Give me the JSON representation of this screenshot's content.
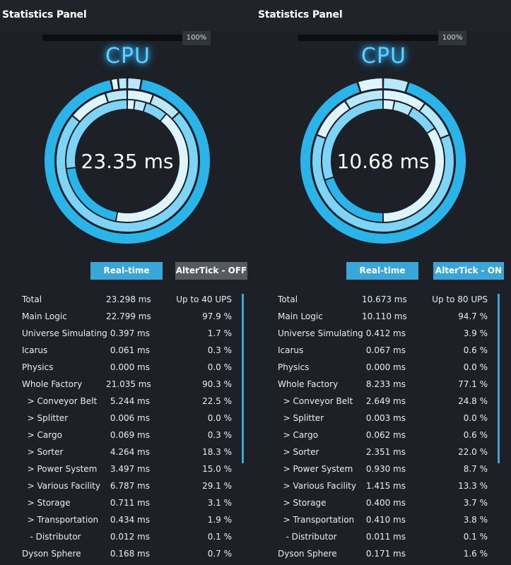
{
  "colors": {
    "accent": "#3aa6d8",
    "ring_dark": "#2bb4ea",
    "ring_mid": "#7dd4f6",
    "ring_light": "#b9e8fb",
    "ring_pale": "#dff5fe",
    "button_off": "#565a61"
  },
  "panels": [
    {
      "title": "Statistics Panel",
      "progress": {
        "label": "100%",
        "value": 100
      },
      "cpu_label": "CPU",
      "ring_value": "23.35 ms",
      "buttons": {
        "realtime": "Real-time",
        "altertick": "AlterTick - OFF",
        "altertick_active": false
      },
      "ring_segments": {
        "outer": [
          0.028,
          0.94,
          0.014,
          0.018
        ],
        "middle": [
          0.06,
          0.07,
          0.73,
          0.09,
          0.05
        ],
        "inner": [
          0.02,
          0.03,
          0.06,
          0.42,
          0.2,
          0.27
        ]
      },
      "stats": [
        {
          "name": "Total",
          "ms": "23.298 ms",
          "pct": "Up to 40 UPS"
        },
        {
          "name": "Main Logic",
          "ms": "22.799 ms",
          "pct": "97.9 %"
        },
        {
          "name": "Universe Simulating",
          "ms": "0.397 ms",
          "pct": "1.7 %"
        },
        {
          "name": "Icarus",
          "ms": "0.061 ms",
          "pct": "0.3 %"
        },
        {
          "name": "Physics",
          "ms": "0.000 ms",
          "pct": "0.0 %"
        },
        {
          "name": "Whole Factory",
          "ms": "21.035 ms",
          "pct": "90.3 %"
        },
        {
          "name": "  > Conveyor Belt",
          "ms": "5.244 ms",
          "pct": "22.5 %"
        },
        {
          "name": "  > Splitter",
          "ms": "0.006 ms",
          "pct": "0.0 %"
        },
        {
          "name": "  > Cargo",
          "ms": "0.069 ms",
          "pct": "0.3 %"
        },
        {
          "name": "  > Sorter",
          "ms": "4.264 ms",
          "pct": "18.3 %"
        },
        {
          "name": "  > Power System",
          "ms": "3.497 ms",
          "pct": "15.0 %"
        },
        {
          "name": "  > Various Facility",
          "ms": "6.787 ms",
          "pct": "29.1 %"
        },
        {
          "name": "  > Storage",
          "ms": "0.711 ms",
          "pct": "3.1 %"
        },
        {
          "name": "  > Transportation",
          "ms": "0.434 ms",
          "pct": "1.9 %"
        },
        {
          "name": "   - Distributor",
          "ms": "0.012 ms",
          "pct": "0.1 %"
        },
        {
          "name": "Dyson Sphere",
          "ms": "0.168 ms",
          "pct": "0.7 %"
        }
      ]
    },
    {
      "title": "Statistics Panel",
      "progress": {
        "label": "100%",
        "value": 100
      },
      "cpu_label": "CPU",
      "ring_value": "10.68 ms",
      "buttons": {
        "realtime": "Real-time",
        "altertick": "AlterTick - ON",
        "altertick_active": true
      },
      "ring_segments": {
        "outer": [
          0.05,
          0.9,
          0.05
        ],
        "middle": [
          0.1,
          0.09,
          0.62,
          0.1,
          0.09
        ],
        "inner": [
          0.03,
          0.05,
          0.08,
          0.34,
          0.2,
          0.3
        ]
      },
      "stats": [
        {
          "name": "Total",
          "ms": "10.673 ms",
          "pct": "Up to 80 UPS"
        },
        {
          "name": "Main Logic",
          "ms": "10.110 ms",
          "pct": "94.7 %"
        },
        {
          "name": "Universe Simulating",
          "ms": "0.412 ms",
          "pct": "3.9 %"
        },
        {
          "name": "Icarus",
          "ms": "0.067 ms",
          "pct": "0.6 %"
        },
        {
          "name": "Physics",
          "ms": "0.000 ms",
          "pct": "0.0 %"
        },
        {
          "name": "Whole Factory",
          "ms": "8.233 ms",
          "pct": "77.1 %"
        },
        {
          "name": "  > Conveyor Belt",
          "ms": "2.649 ms",
          "pct": "24.8 %"
        },
        {
          "name": "  > Splitter",
          "ms": "0.003 ms",
          "pct": "0.0 %"
        },
        {
          "name": "  > Cargo",
          "ms": "0.062 ms",
          "pct": "0.6 %"
        },
        {
          "name": "  > Sorter",
          "ms": "2.351 ms",
          "pct": "22.0 %"
        },
        {
          "name": "  > Power System",
          "ms": "0.930 ms",
          "pct": "8.7 %"
        },
        {
          "name": "  > Various Facility",
          "ms": "1.415 ms",
          "pct": "13.3 %"
        },
        {
          "name": "  > Storage",
          "ms": "0.400 ms",
          "pct": "3.7 %"
        },
        {
          "name": "  > Transportation",
          "ms": "0.410 ms",
          "pct": "3.8 %"
        },
        {
          "name": "   - Distributor",
          "ms": "0.011 ms",
          "pct": "0.1 %"
        },
        {
          "name": "Dyson Sphere",
          "ms": "0.171 ms",
          "pct": "1.6 %"
        }
      ]
    }
  ]
}
